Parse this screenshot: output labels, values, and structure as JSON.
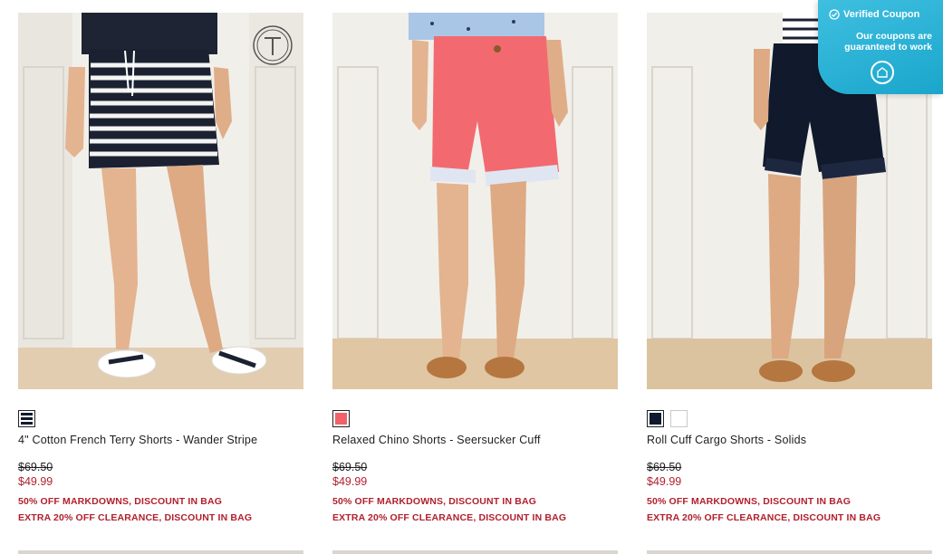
{
  "products": [
    {
      "name": "4\" Cotton French Terry Shorts - Wander Stripe",
      "original_price": "$69.50",
      "sale_price": "$49.99",
      "promo_1": "50% OFF MARKDOWNS, DISCOUNT IN BAG",
      "promo_2": "EXTRA 20% OFF CLEARANCE, DISCOUNT IN BAG",
      "swatches": [
        "navy-white stripe"
      ]
    },
    {
      "name": "Relaxed Chino Shorts - Seersucker Cuff",
      "original_price": "$69.50",
      "sale_price": "$49.99",
      "promo_1": "50% OFF MARKDOWNS, DISCOUNT IN BAG",
      "promo_2": "EXTRA 20% OFF CLEARANCE, DISCOUNT IN BAG",
      "swatches": [
        "coral"
      ]
    },
    {
      "name": "Roll Cuff Cargo Shorts - Solids",
      "original_price": "$69.50",
      "sale_price": "$49.99",
      "promo_1": "50% OFF MARKDOWNS, DISCOUNT IN BAG",
      "promo_2": "EXTRA 20% OFF CLEARANCE, DISCOUNT IN BAG",
      "swatches": [
        "navy",
        "white"
      ]
    }
  ],
  "coupon_badge": {
    "title": "Verified Coupon",
    "subtitle": "Our coupons are guaranteed to work",
    "icons": [
      "check-circle-icon",
      "coupon-logo-icon"
    ]
  },
  "colors": {
    "sale_red": "#b1202d",
    "navy": "#0f1a2e",
    "coral": "#f16169",
    "badge_blue": "#1aa6cc"
  },
  "brand_mark": "T"
}
